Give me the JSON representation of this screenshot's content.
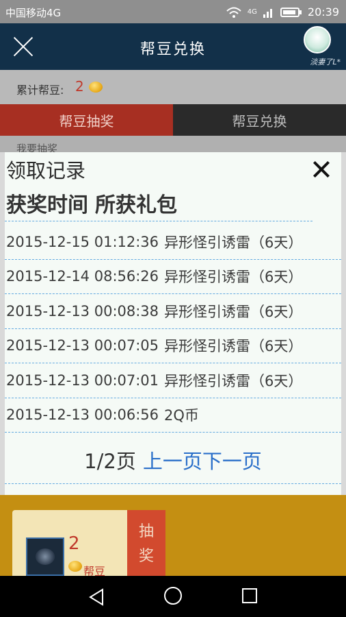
{
  "status_bar": {
    "carrier": "中国移动4G",
    "network": "4G",
    "time": "20:39"
  },
  "header": {
    "title": "帮豆兑换",
    "avatar_name": "淡妻了L*"
  },
  "beans": {
    "label": "累计帮豆:",
    "count": "2"
  },
  "tabs": [
    {
      "label": "帮豆抽奖",
      "active": true
    },
    {
      "label": "帮豆兑换",
      "active": false
    }
  ],
  "background": {
    "partial_text": "我要抽奖"
  },
  "modal": {
    "title": "领取记录",
    "col_time": "获奖时间",
    "col_gift": "所获礼包",
    "records": [
      {
        "time": "2015-12-15 01:12:36",
        "gift": "异形怪引诱雷（6天）"
      },
      {
        "time": "2015-12-14 08:56:26",
        "gift": "异形怪引诱雷（6天）"
      },
      {
        "time": "2015-12-13 00:08:38",
        "gift": "异形怪引诱雷（6天）"
      },
      {
        "time": "2015-12-13 00:07:05",
        "gift": "异形怪引诱雷（6天）"
      },
      {
        "time": "2015-12-13 00:07:01",
        "gift": "异形怪引诱雷（6天）"
      },
      {
        "time": "2015-12-13 00:06:56",
        "gift": "2Q币"
      }
    ],
    "page_info": "1/2页",
    "prev_label": "上一页",
    "next_label": "下一页"
  },
  "ticket": {
    "count": "2",
    "bean_label": "帮豆",
    "draw_label_1": "抽",
    "draw_label_2": "奖"
  },
  "colors": {
    "header_bg": "#123049",
    "tab_active": "#a72f22",
    "link": "#2a6fc9",
    "dash": "#62a9e0"
  }
}
